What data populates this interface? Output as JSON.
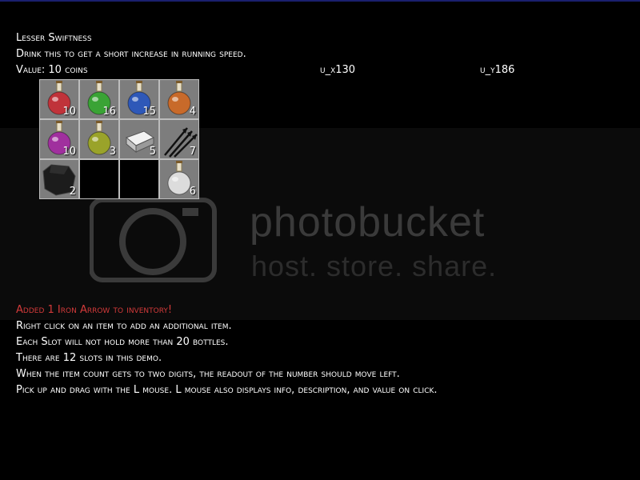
{
  "item_info": {
    "name": "Lesser Swiftness",
    "description": "Drink this to get a short increase in running speed.",
    "value": "Value: 10 coins",
    "coord_x": "u_x130",
    "coord_y": "u_y186"
  },
  "inventory": {
    "slots": [
      {
        "icon": "red-potion-icon",
        "color": "#c0333a",
        "count": "10"
      },
      {
        "icon": "green-potion-icon",
        "color": "#3aa335",
        "count": "16"
      },
      {
        "icon": "blue-potion-icon",
        "color": "#2e58b8",
        "count": "15"
      },
      {
        "icon": "orange-potion-icon",
        "color": "#c86a2a",
        "count": "4"
      },
      {
        "icon": "purple-potion-icon",
        "color": "#a0309e",
        "count": "10"
      },
      {
        "icon": "yellow-green-potion-icon",
        "color": "#9aa32a",
        "count": "3"
      },
      {
        "icon": "iron-ingot-icon",
        "color": "#d8d8d8",
        "count": "5"
      },
      {
        "icon": "iron-arrows-icon",
        "color": "#222222",
        "count": "7"
      },
      {
        "icon": "coal-icon",
        "color": "#1a1a1a",
        "count": "2"
      },
      {
        "icon": "empty-slot",
        "color": "#000000",
        "count": ""
      },
      {
        "icon": "empty-slot",
        "color": "#000000",
        "count": ""
      },
      {
        "icon": "white-potion-icon",
        "color": "#dcdcdc",
        "count": "6"
      }
    ]
  },
  "log": {
    "status": "Added 1 Iron Arrow to inventory!",
    "status_color": "#d33a3a",
    "lines": [
      "Right click on an item to add an additional item.",
      "Each Slot will not hold more than 20 bottles.",
      "There are 12 slots in this demo.",
      "When the item count gets to two digits, the readout of the number should move left.",
      "Pick up and drag with the L mouse.  L mouse also displays info, description, and value on click."
    ]
  },
  "watermark": {
    "brand": "photobucket",
    "tagline": "host. store. share."
  }
}
